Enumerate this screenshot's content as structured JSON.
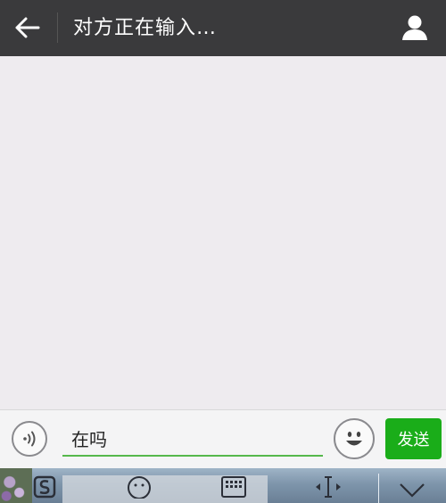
{
  "header": {
    "title": "对方正在输入…",
    "back_icon": "arrow-left-icon",
    "profile_icon": "person-icon"
  },
  "input_bar": {
    "message_value": "在吗",
    "send_label": "发送",
    "voice_icon": "voice-icon",
    "emoji_icon": "smiley-icon"
  },
  "keyboard_toolbar": {
    "items": [
      "sogou-logo-icon",
      "emoji-icon",
      "keyboard-icon",
      "cursor-move-icon",
      "collapse-chevron-icon"
    ]
  },
  "colors": {
    "header_bg": "#3a3a3c",
    "chat_bg": "#eeebef",
    "send_button": "#1aad19",
    "input_underline": "#55b84b"
  }
}
